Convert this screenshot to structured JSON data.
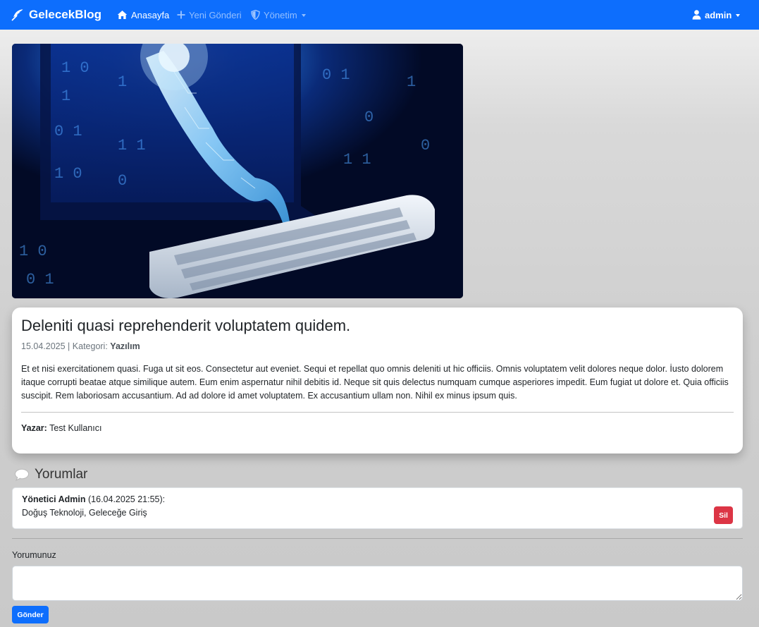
{
  "navbar": {
    "brand": "GelecekBlog",
    "items": [
      {
        "label": "Anasayfa",
        "icon": "home-icon",
        "active": true
      },
      {
        "label": "Yeni Gönderi",
        "icon": "plus-icon",
        "active": false
      },
      {
        "label": "Yönetim",
        "icon": "shield-icon",
        "active": false,
        "dropdown": true
      }
    ],
    "user": {
      "label": "admin",
      "icon": "user-icon",
      "dropdown": true
    }
  },
  "post": {
    "image_alt_icon": "robot-hand-keyboard-image",
    "title": "Deleniti quasi reprehenderit voluptatem quidem.",
    "date": "15.04.2025",
    "meta_separator": "|",
    "category_label": "Kategori:",
    "category": "Yazılım",
    "body": "Et et nisi exercitationem quasi. Fuga ut sit eos. Consectetur aut eveniet. Sequi et repellat quo omnis deleniti ut hic officiis. Omnis voluptatem velit dolores neque dolor. İusto dolorem itaque corrupti beatae atque similique autem. Eum enim aspernatur nihil debitis id. Neque sit quis delectus numquam cumque asperiores impedit. Eum fugiat ut dolore et. Quia officiis suscipit. Rem laboriosam accusantium. Ad ad dolore id amet voluptatem. Ex accusantium ullam non. Nihil ex minus ipsum quis.",
    "author_label": "Yazar:",
    "author": "Test Kullanıcı"
  },
  "comments": {
    "heading": "Yorumlar",
    "items": [
      {
        "author": "Yönetici Admin",
        "timestamp": "(16.04.2025 21:55):",
        "text": "Doğuş Teknoloji, Geleceğe Giriş",
        "delete_label": "Sil"
      }
    ],
    "form": {
      "label": "Yorumunuz",
      "value": "",
      "submit_label": "Gönder"
    }
  },
  "colors": {
    "primary": "#0d6efd",
    "danger": "#dc3545"
  }
}
